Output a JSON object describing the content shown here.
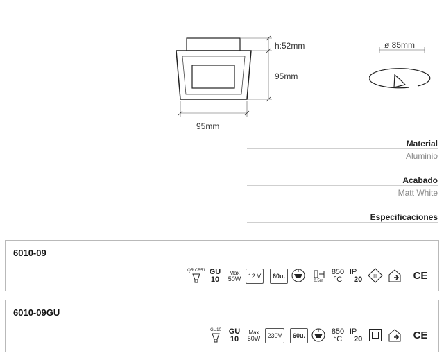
{
  "drawing": {
    "height_label": "h:52mm",
    "side_label": "95mm",
    "width_label": "95mm",
    "cutout_label": "ø 85mm"
  },
  "specs": [
    {
      "label": "Material",
      "value": "Aluminio"
    },
    {
      "label": "Acabado",
      "value": "Matt White"
    },
    {
      "label": "Especificaciones",
      "value": ""
    }
  ],
  "products": [
    {
      "code": "6010-09",
      "lamp_label": "QR CB51",
      "socket_top": "GU",
      "socket_bottom": "10",
      "max_top": "Max",
      "max_bottom": "50W",
      "voltage": "12 V",
      "pack": "60u.",
      "distance": "0.5m",
      "temp_top": "850",
      "temp_bottom": "°C",
      "ip_top": "IP",
      "ip_bottom": "20",
      "class_symbol": "III",
      "ce": "CE"
    },
    {
      "code": "6010-09GU",
      "lamp_label": "GU10",
      "socket_top": "GU",
      "socket_bottom": "10",
      "max_top": "Max",
      "max_bottom": "50W",
      "voltage": "230V",
      "pack": "60u.",
      "temp_top": "850",
      "temp_bottom": "°C",
      "ip_top": "IP",
      "ip_bottom": "20",
      "ce": "CE"
    }
  ]
}
